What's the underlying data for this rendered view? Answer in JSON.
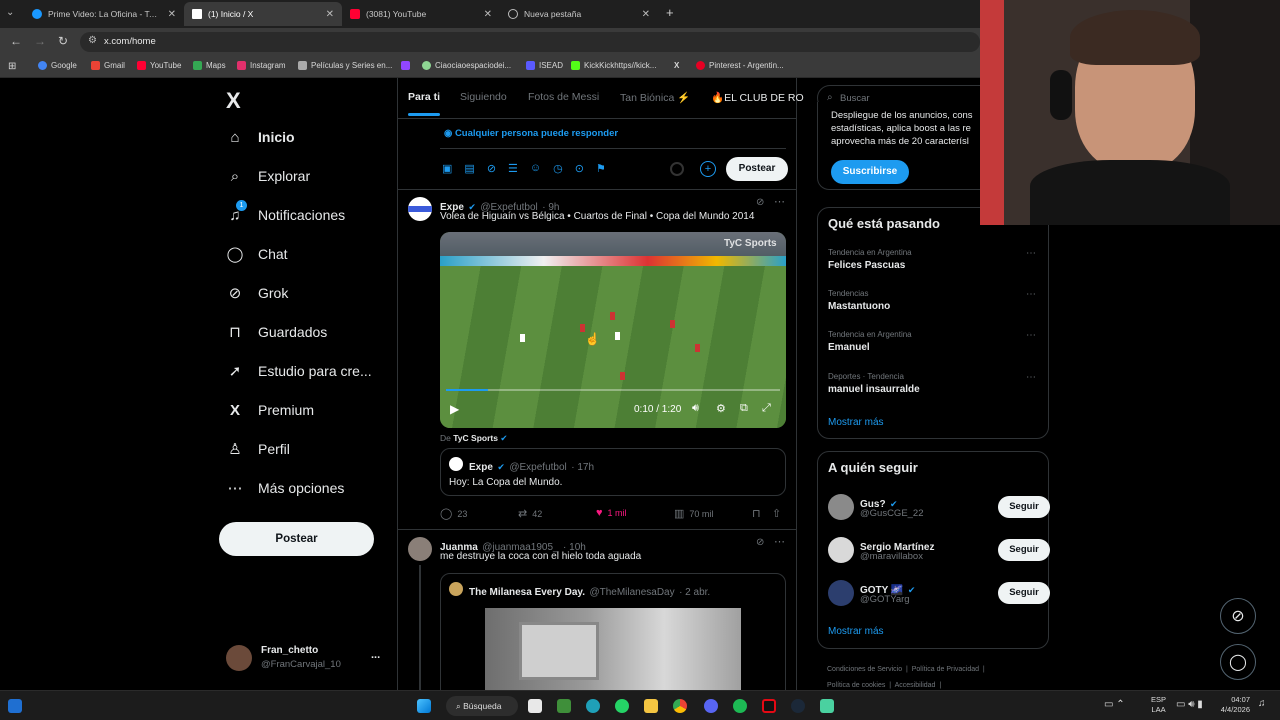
{
  "browser": {
    "tabs": [
      {
        "title": "Prime Video: La Oficina - Temp...",
        "color": "#1a98ff"
      },
      {
        "title": "(1) Inicio / X",
        "color": "#ffffff"
      },
      {
        "title": "(3081) YouTube",
        "color": "#ff0033"
      },
      {
        "title": "Nueva pestaña",
        "color": "#bbbbbb"
      }
    ],
    "new_tab": "+",
    "url": "x.com/home",
    "bookmarks": [
      {
        "label": "Google",
        "color": "#4285f4"
      },
      {
        "label": "Gmail",
        "color": "#ea4335"
      },
      {
        "label": "YouTube",
        "color": "#ff0033"
      },
      {
        "label": "Maps",
        "color": "#34a853"
      },
      {
        "label": "Instagram",
        "color": "#e1306c"
      },
      {
        "label": "Películas y Series en...",
        "color": "#aaaaaa"
      },
      {
        "label": "",
        "color": "#9146ff"
      },
      {
        "label": "Ciaociaoespaciodei...",
        "color": "#8fd694"
      },
      {
        "label": "ISEAD",
        "color": "#5a5aff"
      },
      {
        "label": "KickKickhttps//kick...",
        "color": "#53fc18"
      },
      {
        "label": "",
        "color": "#ffffff"
      },
      {
        "label": "Pinterest - Argentin...",
        "color": "#e60023"
      }
    ]
  },
  "sidebar": {
    "logo": "X",
    "items": [
      {
        "label": "Inicio",
        "icon": "home-icon",
        "glyph": "⌂"
      },
      {
        "label": "Explorar",
        "icon": "search-icon",
        "glyph": "⌕"
      },
      {
        "label": "Notificaciones",
        "icon": "bell-icon",
        "glyph": "🔔"
      },
      {
        "label": "Chat",
        "icon": "chat-icon",
        "glyph": "◯"
      },
      {
        "label": "Grok",
        "icon": "grok-icon",
        "glyph": "⊘"
      },
      {
        "label": "Guardados",
        "icon": "bookmark-icon",
        "glyph": "⊓"
      },
      {
        "label": "Estudio para cre...",
        "icon": "rocket-icon",
        "glyph": "➚"
      },
      {
        "label": "Premium",
        "icon": "x-premium-icon",
        "glyph": "X"
      },
      {
        "label": "Perfil",
        "icon": "person-icon",
        "glyph": "♙"
      },
      {
        "label": "Más opciones",
        "icon": "more-circle-icon",
        "glyph": "⋯"
      }
    ],
    "notif_badge": "1",
    "post_label": "Postear",
    "account": {
      "name": "Fran_chetto",
      "handle": "@FranCarvajal_10",
      "more": "..."
    }
  },
  "feed": {
    "tabs": [
      "Para ti",
      "Siguiendo",
      "Fotos de Messi",
      "Tan Biónica ⚡",
      "🔥EL CLUB DE RO"
    ],
    "composer": {
      "reply_setting": "Cualquier persona puede responder",
      "post_label": "Postear"
    },
    "tweet1": {
      "name": "Expe",
      "handle": "@Expefutbol",
      "time": "· 9h",
      "text": "Volea de Higuaín vs Bélgica • Cuartos de Final • Copa del Mundo 2014",
      "video_time": "0:10 / 1:20",
      "watermark": "TyC Sports",
      "from_label": "De",
      "from_name": "TyC Sports",
      "quote": {
        "name": "Expe",
        "handle": "@Expefutbol",
        "time": "· 17h",
        "text": "Hoy: La Copa del Mundo."
      },
      "replies": "23",
      "reposts": "42",
      "likes": "1 mil",
      "views": "70 mil"
    },
    "tweet2": {
      "name": "Juanma",
      "handle": "@juanmaa1905_",
      "time": "· 10h",
      "text": "me destruye la coca con el hielo toda aguada",
      "quote": {
        "name": "The Milanesa Every Day.",
        "handle": "@TheMilanesaDay",
        "time": "· 2 abr."
      }
    }
  },
  "right": {
    "search_placeholder": "Buscar",
    "premium": {
      "text1": "Despliegue de los anuncios, cons",
      "text2": "estadísticas, aplica boost a las re",
      "text3": "aprovecha más de 20 caracterísl",
      "button": "Suscribirse"
    },
    "trends_title": "Qué está pasando",
    "trends": [
      {
        "meta": "Tendencia en Argentina",
        "name": "Felices Pascuas"
      },
      {
        "meta": "Tendencias",
        "name": "Mastantuono"
      },
      {
        "meta": "Tendencia en Argentina",
        "name": "Emanuel"
      },
      {
        "meta": "Deportes · Tendencia",
        "name": "manuel insaurralde"
      }
    ],
    "show_more": "Mostrar más",
    "follow_title": "A quién seguir",
    "follow": [
      {
        "name": "Gus?",
        "handle": "@GusCGE_22",
        "button": "Seguir"
      },
      {
        "name": "Sergio Martínez",
        "handle": "@maravillabox",
        "button": "Seguir"
      },
      {
        "name": "GOTY 🌌",
        "handle": "@GOTYarg",
        "button": "Seguir"
      }
    ],
    "follow_more": "Mostrar más",
    "footer": [
      "Condiciones de Servicio",
      "Política de Privacidad",
      "Política de cookies",
      "Accesibilidad"
    ]
  },
  "taskbar": {
    "search": "Búsqueda",
    "lang": "ESP",
    "lang2": "LAA",
    "time": "04:07",
    "date": "4/4/2026"
  }
}
